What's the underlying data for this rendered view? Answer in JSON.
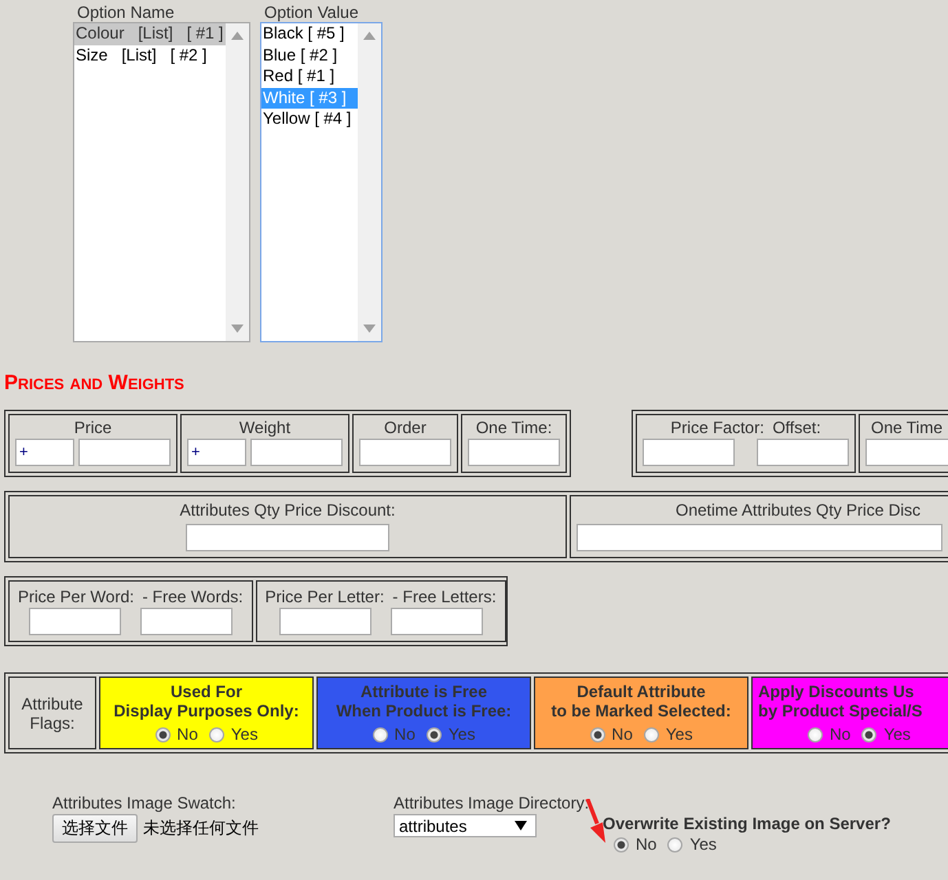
{
  "listboxes": [
    {
      "label": "Option Name",
      "focused": false,
      "items": [
        {
          "label": "Colour   [List]   [ #1 ]",
          "selected": true
        },
        {
          "label": "Size   [List]   [ #2 ]",
          "selected": false
        }
      ]
    },
    {
      "label": "Option Value",
      "focused": true,
      "items": [
        {
          "label": "Black [ #5 ]",
          "selected": false
        },
        {
          "label": "Blue [ #2 ]",
          "selected": false
        },
        {
          "label": "Red [ #1 ]",
          "selected": false
        },
        {
          "label": "White [ #3 ]",
          "selected": true
        },
        {
          "label": "Yellow [ #4 ]",
          "selected": false
        }
      ]
    }
  ],
  "section_title": "Prices and Weights",
  "price_row": [
    [
      {
        "labels": [
          "Price"
        ],
        "fields": [
          {
            "kind": "prefix",
            "value": "+"
          },
          {
            "kind": "amount"
          }
        ]
      },
      {
        "labels": [
          "Weight"
        ],
        "fields": [
          {
            "kind": "prefix",
            "value": "+"
          },
          {
            "kind": "amount"
          }
        ]
      },
      {
        "labels": [
          "Order"
        ],
        "fields": [
          {
            "kind": "amount"
          }
        ]
      },
      {
        "labels": [
          "One Time:"
        ],
        "fields": [
          {
            "kind": "wide"
          }
        ]
      }
    ],
    [
      {
        "labels": [
          "Price Factor:",
          "Offset:"
        ],
        "fields": [
          {
            "kind": "amount"
          },
          {
            "kind": "amount"
          }
        ]
      },
      {
        "labels": [
          "One Time"
        ],
        "fields": [
          {
            "kind": "wide"
          }
        ]
      }
    ]
  ],
  "discount_row": [
    {
      "labels": [
        "Attributes Qty Price Discount:"
      ],
      "fields": [
        {
          "kind": "full"
        }
      ]
    },
    {
      "labels": [
        "Onetime Attributes Qty Price Disc"
      ],
      "fields": [
        {
          "kind": "full"
        }
      ]
    }
  ],
  "text_price_row": [
    {
      "labels": [
        "Price Per Word:",
        "- Free Words:"
      ],
      "fields": [
        {
          "kind": "amount"
        },
        {
          "kind": "amount"
        }
      ]
    },
    {
      "labels": [
        "Price Per Letter:",
        "- Free Letters:"
      ],
      "fields": [
        {
          "kind": "amount"
        },
        {
          "kind": "amount"
        }
      ]
    }
  ],
  "flags": {
    "label": "Attribute Flags:",
    "items": [
      {
        "title": [
          "Used For",
          "Display Purposes Only:"
        ],
        "color": "#ffff00",
        "options": [
          {
            "label": "No",
            "selected": true
          },
          {
            "label": "Yes",
            "selected": false
          }
        ]
      },
      {
        "title": [
          "Attribute is Free",
          "When Product is Free:"
        ],
        "color": "#3355ee",
        "options": [
          {
            "label": "No",
            "selected": false
          },
          {
            "label": "Yes",
            "selected": true
          }
        ]
      },
      {
        "title": [
          "Default Attribute",
          "to be Marked Selected:"
        ],
        "color": "#ffa04a",
        "options": [
          {
            "label": "No",
            "selected": true
          },
          {
            "label": "Yes",
            "selected": false
          }
        ]
      },
      {
        "title": [
          "Apply Discounts Us",
          "by Product Special/S"
        ],
        "color": "#ff00ff",
        "options": [
          {
            "label": "No",
            "selected": false
          },
          {
            "label": "Yes",
            "selected": true
          }
        ]
      }
    ]
  },
  "image": {
    "swatch_label": "Attributes Image Swatch:",
    "file_button": "选择文件",
    "file_status": "未选择任何文件",
    "directory_label": "Attributes Image Directory:",
    "directory_value": "attributes",
    "overwrite_label": "Overwrite Existing Image on Server?",
    "overwrite_options": [
      {
        "label": "No",
        "selected": true
      },
      {
        "label": "Yes",
        "selected": false
      }
    ]
  }
}
